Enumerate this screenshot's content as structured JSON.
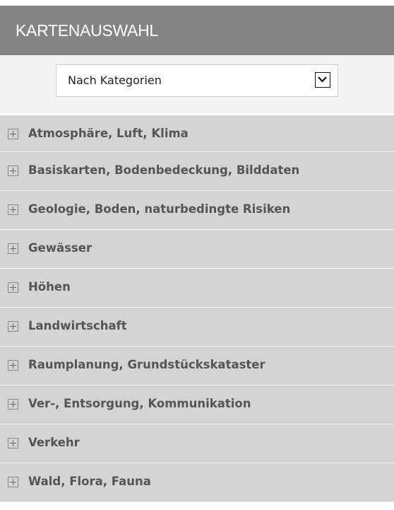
{
  "header": {
    "title": "KARTENAUSWAHL"
  },
  "filter": {
    "selected": "Nach Kategorien",
    "arrow_icon": "chevron-down-icon"
  },
  "categories": [
    {
      "label": "Atmosphäre, Luft, Klima",
      "icon": "expand-plus-icon"
    },
    {
      "label": "Basiskarten, Bodenbedeckung, Bilddaten",
      "icon": "expand-plus-icon"
    },
    {
      "label": "Geologie, Boden, naturbedingte Risiken",
      "icon": "expand-plus-icon"
    },
    {
      "label": "Gewässer",
      "icon": "expand-plus-icon"
    },
    {
      "label": "Höhen",
      "icon": "expand-plus-icon"
    },
    {
      "label": "Landwirtschaft",
      "icon": "expand-plus-icon"
    },
    {
      "label": "Raumplanung, Grundstückskataster",
      "icon": "expand-plus-icon"
    },
    {
      "label": "Ver-, Entsorgung, Kommunikation",
      "icon": "expand-plus-icon"
    },
    {
      "label": "Verkehr",
      "icon": "expand-plus-icon"
    },
    {
      "label": "Wald, Flora, Fauna",
      "icon": "expand-plus-icon"
    }
  ],
  "colors": {
    "header_bg": "#848484",
    "header_text": "#ffffff",
    "filter_area_bg": "#f3f3f3",
    "item_bg": "#d4d4d4",
    "item_text": "#555555"
  }
}
